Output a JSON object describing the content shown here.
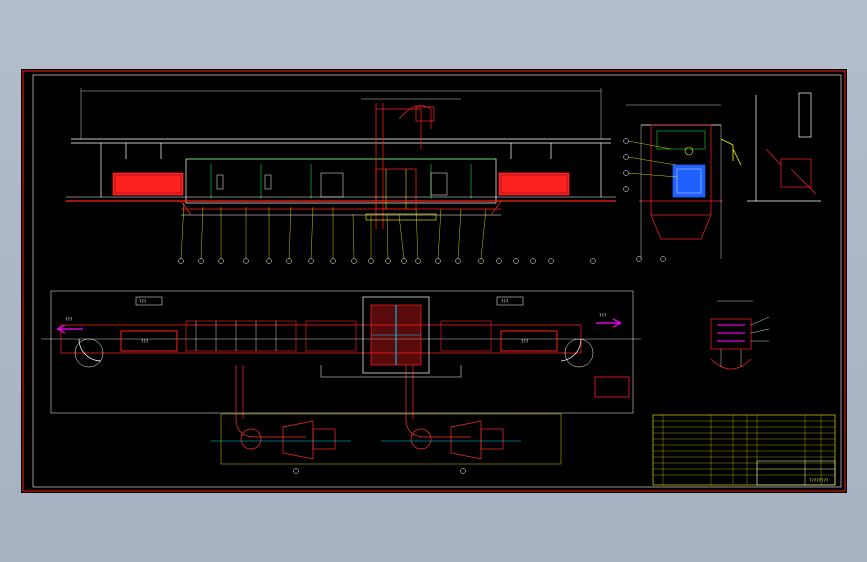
{
  "viewport": {
    "background": "#a9b4c4"
  },
  "drawing": {
    "sheet_color": "#000000",
    "border_color": "#d01818",
    "line_colors": {
      "outline": "#ffffff",
      "part": "#ff2020",
      "hidden": "#ffff00",
      "motor": "#2060ff",
      "accent": "#00d0ff",
      "piping": "#ff3030",
      "arrow": "#e000e0",
      "green": "#20ff40"
    },
    "labels": {
      "hopper_left": "???",
      "hopper_right": "???",
      "arrow_left": "???",
      "arrow_right": "???",
      "box_left": "???",
      "box_right": "???"
    }
  },
  "title_block": {
    "title_text": "????????"
  }
}
